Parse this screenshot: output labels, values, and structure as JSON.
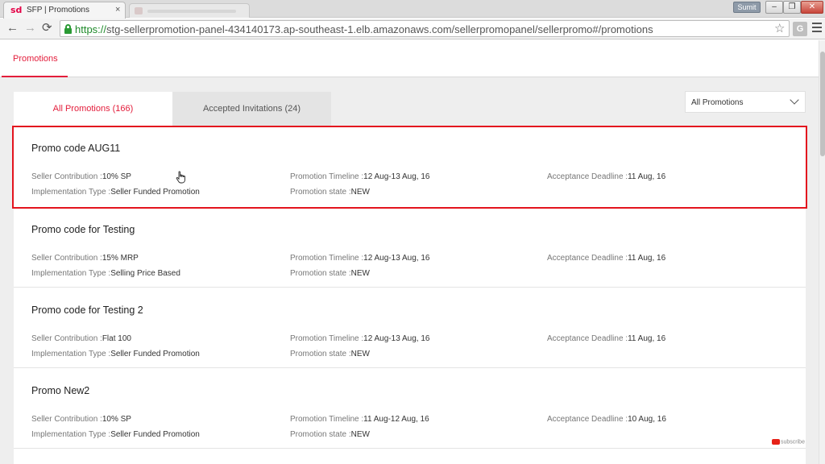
{
  "browser": {
    "active_tab": {
      "favicon": "sd",
      "title": "SFP | Promotions",
      "close": "×"
    },
    "profile_name": "Sumit",
    "window_controls": {
      "minimize": "–",
      "restore": "❐",
      "close": "✕"
    },
    "nav": {
      "back": "←",
      "forward": "→",
      "reload": "⟳"
    },
    "url_scheme": "https://",
    "url_rest": "stg-sellerpromotion-panel-434140173.ap-southeast-1.elb.amazonaws.com/sellerpromopanel/sellerpromo#/promotions",
    "bookmark_star": "☆",
    "extension_label": "G"
  },
  "topnav": {
    "active_tab": "Promotions"
  },
  "tabs": {
    "all": "All Promotions (166)",
    "accepted": "Accepted Invitations (24)"
  },
  "filter": {
    "selected": "All Promotions"
  },
  "labels": {
    "seller_contribution": "Seller Contribution :",
    "implementation_type": "Implementation Type :",
    "promotion_timeline": "Promotion Timeline :",
    "promotion_state": "Promotion state :",
    "acceptance_deadline": "Acceptance Deadline :"
  },
  "promotions": [
    {
      "title": "Promo code AUG11",
      "seller_contribution": "10% SP",
      "implementation_type": "Seller Funded Promotion",
      "timeline": "12 Aug-13 Aug, 16",
      "state": "NEW",
      "deadline": "11 Aug, 16",
      "selected": true
    },
    {
      "title": "Promo code for Testing",
      "seller_contribution": "15% MRP",
      "implementation_type": "Selling Price Based",
      "timeline": "12 Aug-13 Aug, 16",
      "state": "NEW",
      "deadline": "11 Aug, 16"
    },
    {
      "title": "Promo code for Testing 2",
      "seller_contribution": "Flat 100",
      "implementation_type": "Seller Funded Promotion",
      "timeline": "12 Aug-13 Aug, 16",
      "state": "NEW",
      "deadline": "11 Aug, 16"
    },
    {
      "title": "Promo New2",
      "seller_contribution": "10% SP",
      "implementation_type": "Seller Funded Promotion",
      "timeline": "11 Aug-12 Aug, 16",
      "state": "NEW",
      "deadline": "10 Aug, 16"
    }
  ],
  "overlay": {
    "subscribe_label": "subscribe"
  },
  "colors": {
    "accent": "#e31d3b",
    "selection_border": "#e3141e",
    "url_green": "#1f8a2a"
  }
}
